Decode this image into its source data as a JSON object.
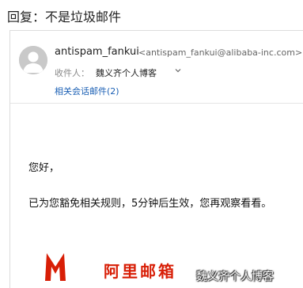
{
  "email": {
    "subject": "回复：不是垃圾邮件",
    "sender": {
      "name": "antispam_fankui",
      "address": "<antispam_fankui@alibaba-inc.com>"
    },
    "to": {
      "label": "收件人：",
      "value": "魏义齐个人博客"
    },
    "related_link": "相关会话邮件(2)",
    "body": {
      "greeting": "您好，",
      "message": "已为您豁免相关规则，5分钟后生效，您再观察看看。"
    },
    "logo_text": "阿里邮箱"
  },
  "watermark": "魏义齐个人博客",
  "colors": {
    "brand": "#d81e06",
    "link": "#1a5fb4",
    "avatar_bg": "#c9c9c9"
  },
  "icons": {
    "avatar": "user-avatar-icon",
    "expand": "chevron-down-icon",
    "logo": "aliyun-mail-m-logo"
  }
}
